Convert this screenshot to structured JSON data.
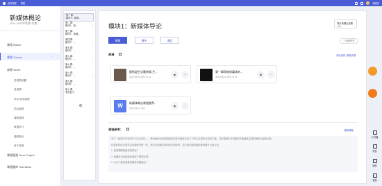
{
  "topbar": {
    "crumbs": [
      "我的课程",
      "课程"
    ],
    "user": "康家庆"
  },
  "sidebar": {
    "course_title": "新媒体概论",
    "course_sub": "2024-2025学年第1学期",
    "items": [
      {
        "label": "课程 Notice"
      },
      {
        "label": "课程 Course"
      },
      {
        "label": "成绩 Score"
      },
      {
        "label": "课程图谱 Term Project"
      },
      {
        "label": "课程题库 Test Bank"
      }
    ],
    "score_sub": [
      "总成绩设置",
      "总成绩",
      "作业/测试成绩",
      "项目成绩",
      "课堂成绩",
      "数据学习",
      "课堂笔记",
      "线下成绩"
    ]
  },
  "outline": [
    {
      "label": "第一课：",
      "sub": "模块1：新媒..."
    },
    {
      "label": "第二课：",
      "sub": "模块1：新..."
    },
    {
      "label": "第三课：",
      "sub": "模块1：新媒..."
    },
    {
      "label": "第四课：",
      "sub": "模块2：..."
    },
    {
      "label": "第五课：",
      "sub": "模块3：..."
    },
    {
      "label": "第六课：",
      "sub": "模块3：..."
    },
    {
      "label": "第七课：",
      "sub": "模块4：..."
    },
    {
      "label": "第八课：",
      "sub": "模块4：..."
    },
    {
      "label": "第九课：",
      "sub": "模块5：..."
    },
    {
      "label": "第十课：",
      "sub": "考前复习"
    }
  ],
  "main": {
    "title": "模块1：新媒体导论",
    "stat": {
      "line1": "同步到课后设置",
      "line2": "分钟"
    },
    "tabs": [
      "课前",
      "课中",
      "课后"
    ],
    "add_label": "+ 添加环节",
    "resources_label": "资源",
    "resource_links": "添加资源 | 删除资源",
    "resources": [
      {
        "name": "报纸诞生记最终版-生...",
        "meta": "浏览人数:45  时长:01:02"
      },
      {
        "name": "第一章网络新媒体的...",
        "meta": "浏览人数:46  时长:47:38"
      },
      {
        "name": "新媒体概论课程推荐...",
        "meta": "浏览人数:44  时长:"
      }
    ],
    "notes_label": "课程参考：",
    "notes_link": "删除课程",
    "notes_text": [
      "关于「新闻学专业的学习热点事件」，考虑编写传统新闻媒体在新兴媒体冲击之下的生存现状与转型之路，并在课程中补充国内外融媒体实践的案例与最新动态。",
      "在课前阶段安排学生阅读教材第一章，完成对传播学基本概念的梳理，并在课中围绕典型案例展开小组讨论。",
      "1. 如何理解新媒体的特征？",
      "2. 新媒体对传统媒体造成了哪些影响？",
      "3. 为什么要加速推进媒体深度融合？"
    ]
  },
  "tools": [
    "计时器",
    "抢答",
    "随机",
    "签到"
  ]
}
